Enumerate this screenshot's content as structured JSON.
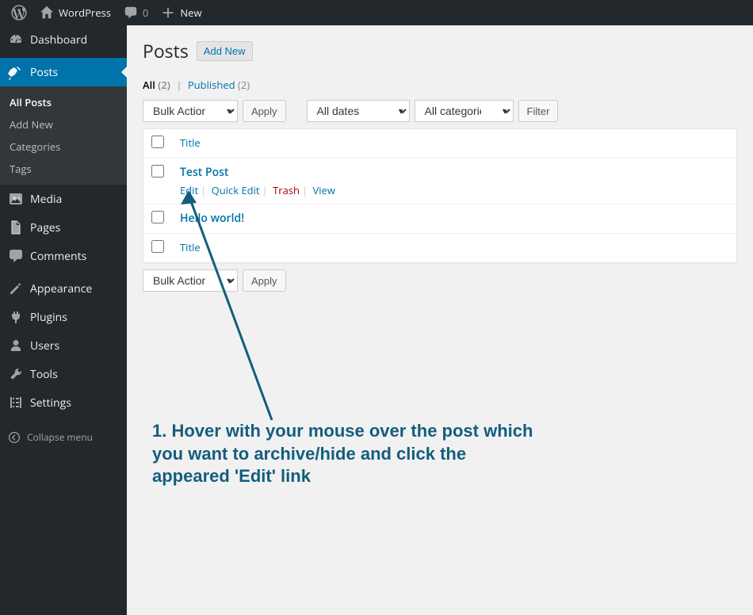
{
  "adminbar": {
    "site_name": "WordPress",
    "comments_count": "0",
    "new_label": "New"
  },
  "sidebar": {
    "dashboard": "Dashboard",
    "posts": "Posts",
    "posts_sub": {
      "all": "All Posts",
      "add": "Add New",
      "cat": "Categories",
      "tags": "Tags"
    },
    "media": "Media",
    "pages": "Pages",
    "comments": "Comments",
    "appearance": "Appearance",
    "plugins": "Plugins",
    "users": "Users",
    "tools": "Tools",
    "settings": "Settings",
    "collapse": "Collapse menu"
  },
  "heading": {
    "title": "Posts",
    "add_new": "Add New"
  },
  "filters": {
    "all_label": "All",
    "all_count": "(2)",
    "published_label": "Published",
    "published_count": "(2)"
  },
  "bulk": {
    "actions_label": "Bulk Actions",
    "apply": "Apply",
    "all_dates": "All dates",
    "all_cats": "All categories",
    "filter": "Filter"
  },
  "table": {
    "col_title": "Title",
    "rows": [
      {
        "title": "Test Post",
        "show_actions": true
      },
      {
        "title": "Hello world!",
        "show_actions": false
      }
    ],
    "actions": {
      "edit": "Edit",
      "quick": "Quick Edit",
      "trash": "Trash",
      "view": "View"
    }
  },
  "annotation": "1. Hover with your mouse over the post which you want to archive/hide and click the appeared 'Edit' link"
}
